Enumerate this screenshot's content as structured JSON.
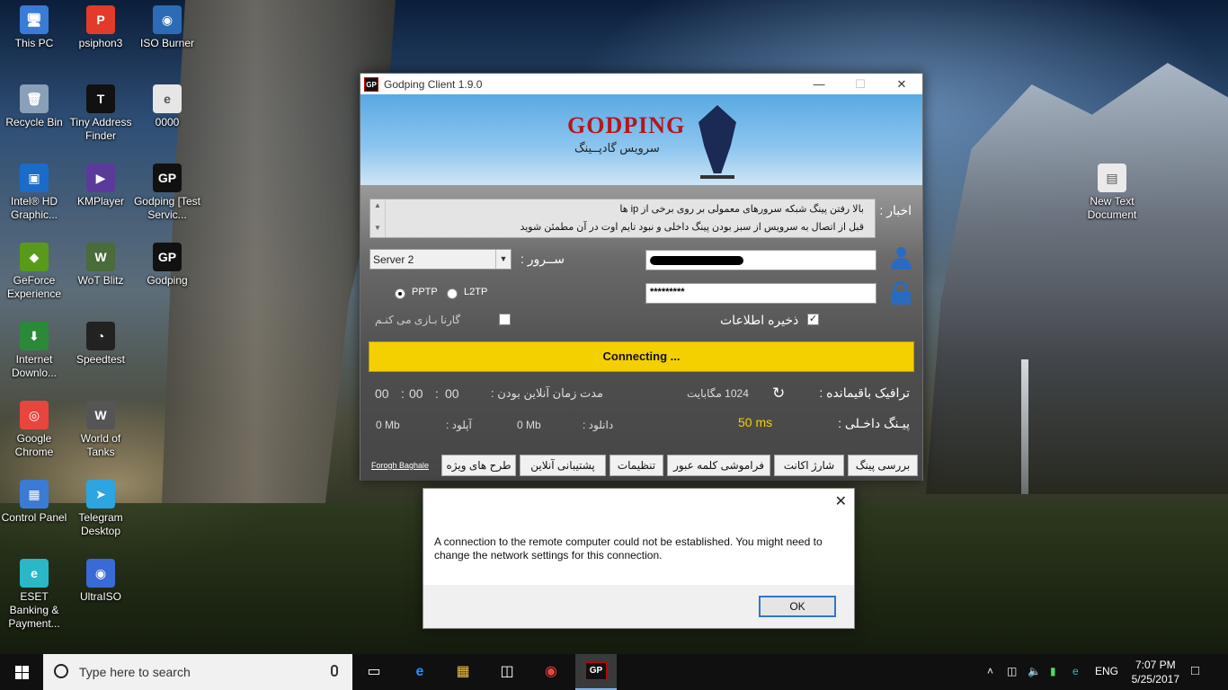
{
  "desktop_icons": [
    {
      "name": "desktop-icon-this-pc",
      "label": "This PC",
      "glyph": "🖥"
    },
    {
      "name": "desktop-icon-psiphon3",
      "label": "psiphon3",
      "glyph": "P"
    },
    {
      "name": "desktop-icon-iso-burner",
      "label": "ISO Burner",
      "glyph": "◉"
    },
    {
      "name": "desktop-icon-recycle-bin",
      "label": "Recycle Bin",
      "glyph": "🗑"
    },
    {
      "name": "desktop-icon-tiny-address-finder",
      "label": "Tiny Address Finder",
      "glyph": "T"
    },
    {
      "name": "desktop-icon-0000",
      "label": "0000",
      "glyph": "e"
    },
    {
      "name": "desktop-icon-intel-hd-graphics",
      "label": "Intel® HD Graphic...",
      "glyph": "▣"
    },
    {
      "name": "desktop-icon-kmplayer",
      "label": "KMPlayer",
      "glyph": "▶"
    },
    {
      "name": "desktop-icon-godping-test",
      "label": "Godping [Test Servic...",
      "glyph": "GP"
    },
    {
      "name": "desktop-icon-geforce-experience",
      "label": "GeForce Experience",
      "glyph": "◆"
    },
    {
      "name": "desktop-icon-wot-blitz",
      "label": "WoT Blitz",
      "glyph": "W"
    },
    {
      "name": "desktop-icon-godping",
      "label": "Godping",
      "glyph": "GP"
    },
    {
      "name": "desktop-icon-internet-download",
      "label": "Internet Downlo...",
      "glyph": "⬇"
    },
    {
      "name": "desktop-icon-speedtest",
      "label": "Speedtest",
      "glyph": "◔"
    },
    {
      "name": "desktop-icon-google-chrome",
      "label": "Google Chrome",
      "glyph": "◎"
    },
    {
      "name": "desktop-icon-world-of-tanks",
      "label": "World of Tanks",
      "glyph": "W"
    },
    {
      "name": "desktop-icon-control-panel",
      "label": "Control Panel",
      "glyph": "▦"
    },
    {
      "name": "desktop-icon-telegram",
      "label": "Telegram Desktop",
      "glyph": "➤"
    },
    {
      "name": "desktop-icon-eset-banking",
      "label": "ESET Banking & Payment...",
      "glyph": "e"
    },
    {
      "name": "desktop-icon-ultraiso",
      "label": "UltraISO",
      "glyph": "◉"
    },
    {
      "name": "desktop-icon-new-text-document",
      "label": "New Text Document",
      "glyph": "▤"
    }
  ],
  "app": {
    "title": "Godping Client 1.9.0",
    "icon_text": "GP",
    "logo_text": "GODPING",
    "logo_subtitle": "سرویس گادپــینگ",
    "news_label": "اخبار :",
    "news_lines": [
      "بالا رفتن پینگ شبکه سرورهای معمولی بر روی برخی از ip ها",
      "قبل از اتصال به سرویس از سبز بودن پینگ داخلی و نبود تایم اوت در آن مطمئن شوید"
    ],
    "server_label": "ســرور :",
    "server_value": "Server 2",
    "password_value": "*********",
    "protocols": [
      "PPTP",
      "L2TP"
    ],
    "protocol_selected": "PPTP",
    "garena_label": "گارنا بـازی می کنـم",
    "garena_checked": false,
    "save_label": "ذخیره اطلاعات",
    "save_checked": true,
    "connect_label": "Connecting ...",
    "traffic_label": "ترافیک باقیمانده :",
    "traffic_value": "1024 مگابایت",
    "online_label": "مدت زمان آنلاین بودن :",
    "online_hours": "00",
    "online_minutes": "00",
    "online_seconds": "00",
    "ping_label": "پیـنگ داخـلی :",
    "ping_value": "50 ms",
    "download_label": "دانلود :",
    "download_value": "0 Mb",
    "upload_label": "آپلود :",
    "upload_value": "0 Mb",
    "credit_link": "Forogh Baghale",
    "buttons": {
      "check_ping": "بررسی پینگ",
      "charge_account": "شارژ اکانت",
      "forgot_password": "فراموشی کلمه عبور",
      "settings": "تنظیمات",
      "online_support": "پشتیبانی آنلاین",
      "special_plans": "طرح های ویژه"
    }
  },
  "dialog": {
    "message": "A connection to the remote computer could not be established.  You might need to change the network settings for this connection.",
    "ok_label": "OK"
  },
  "taskbar": {
    "search_placeholder": "Type here to search",
    "language": "ENG",
    "time": "7:07 PM",
    "date": "5/25/2017",
    "accent_color": "#7fb2e4"
  },
  "colors": {
    "connect_bar": "#f5d000",
    "ping_good": "#f5d000",
    "brand_red": "#b5161c",
    "icon_blue": "#2a6bc2"
  }
}
